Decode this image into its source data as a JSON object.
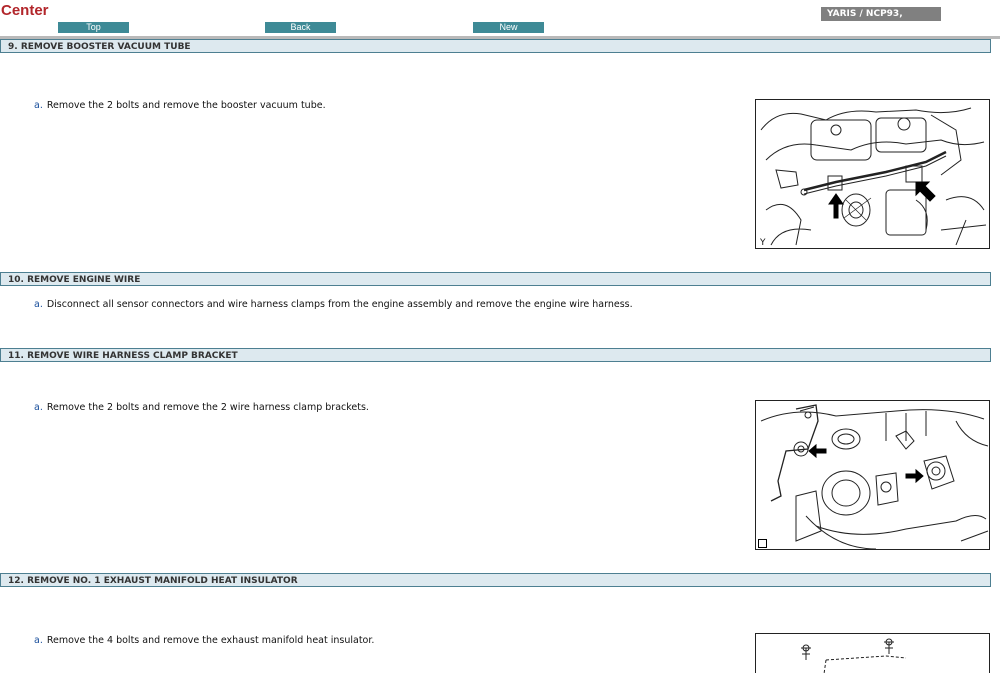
{
  "header": {
    "title": "Center",
    "buttons": {
      "top": "Top",
      "back": "Back",
      "new": "New"
    },
    "model": "YARIS / NCP93,"
  },
  "sections": [
    {
      "heading": "9. REMOVE BOOSTER VACUUM TUBE",
      "steps": [
        {
          "bullet": "a.",
          "text": "Remove the 2 bolts and remove the booster vacuum tube."
        }
      ],
      "figure": {
        "corner_label": "Y"
      }
    },
    {
      "heading": "10. REMOVE ENGINE WIRE",
      "steps": [
        {
          "bullet": "a.",
          "text": "Disconnect all sensor connectors and wire harness clamps from the engine assembly and remove the engine wire harness."
        }
      ]
    },
    {
      "heading": "11. REMOVE WIRE HARNESS CLAMP BRACKET",
      "steps": [
        {
          "bullet": "a.",
          "text": "Remove the 2 bolts and remove the 2 wire harness clamp brackets."
        }
      ]
    },
    {
      "heading": "12. REMOVE NO. 1 EXHAUST MANIFOLD HEAT INSULATOR",
      "steps": [
        {
          "bullet": "a.",
          "text": "Remove the 4 bolts and remove the exhaust manifold heat insulator."
        }
      ]
    }
  ]
}
